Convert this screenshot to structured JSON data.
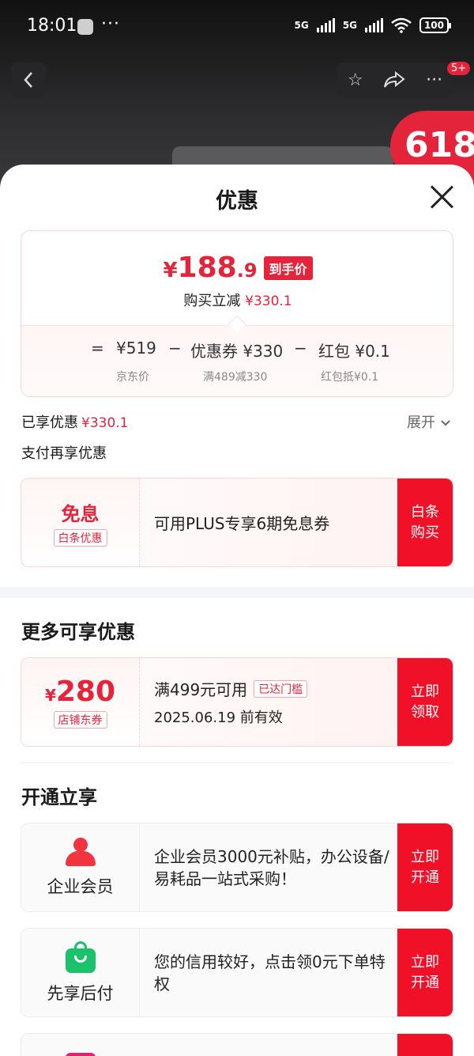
{
  "status_bar": {
    "time": "18:01",
    "network1": "5G",
    "network2": "5G",
    "battery": "100"
  },
  "background_page": {
    "message_badge": "5+",
    "promo_badge": "618"
  },
  "sheet": {
    "title": "优惠",
    "price_card": {
      "final_price_symbol": "¥",
      "final_price_int": "188",
      "final_price_dec": ".9",
      "final_price_tag": "到手价",
      "saving_label": "购买立减",
      "saving_amount": "¥330.1",
      "breakdown": {
        "equals": "=",
        "jd_price": "¥519",
        "minus1": "−",
        "coupon": "优惠券 ¥330",
        "minus2": "−",
        "red_packet": "红包 ¥0.1",
        "jd_price_label": "京东价",
        "coupon_label": "满489减330",
        "red_packet_label": "红包抵¥0.1"
      }
    },
    "enjoyed_label": "已享优惠",
    "enjoyed_amount": "¥330.1",
    "expand_label": "展开",
    "pay_more_label": "支付再享优惠",
    "baitiao": {
      "title": "免息",
      "tag": "白条优惠",
      "desc": "可用PLUS专享6期免息券",
      "action": "白条\n购买"
    },
    "more_title": "更多可享优惠",
    "shop_coupon": {
      "symbol": "¥",
      "amount": "280",
      "tag": "店铺东券",
      "condition": "满499元可用",
      "status": "已达门槛",
      "validity": "2025.06.19 前有效",
      "action": "立即\n领取"
    },
    "open_title": "开通立享",
    "enterprise": {
      "label": "企业会员",
      "desc": "企业会员3000元补贴，办公设备/易耗品一站式采购！",
      "action": "立即\n开通"
    },
    "paylater": {
      "label": "先享后付",
      "desc": "您的信用较好，点击领0元下单特权",
      "action": "立即\n开通"
    }
  }
}
